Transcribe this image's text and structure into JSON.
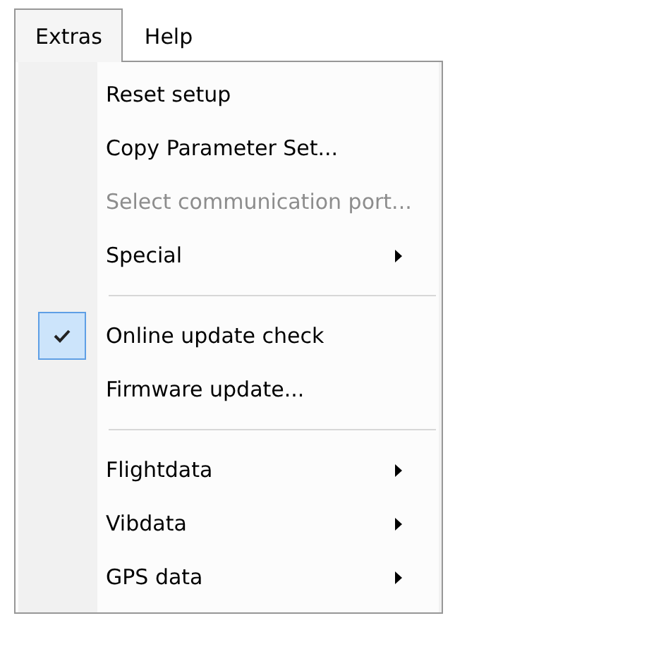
{
  "menubar": [
    {
      "label": "Extras",
      "selected": true
    },
    {
      "label": "Help",
      "selected": false
    }
  ],
  "menu": [
    {
      "kind": "item",
      "label": "Reset setup",
      "disabled": false,
      "checked": false,
      "submenu": false
    },
    {
      "kind": "item",
      "label": "Copy Parameter Set...",
      "disabled": false,
      "checked": false,
      "submenu": false
    },
    {
      "kind": "item",
      "label": "Select communication port...",
      "disabled": true,
      "checked": false,
      "submenu": false
    },
    {
      "kind": "item",
      "label": "Special",
      "disabled": false,
      "checked": false,
      "submenu": true
    },
    {
      "kind": "separator"
    },
    {
      "kind": "item",
      "label": "Online update check",
      "disabled": false,
      "checked": true,
      "submenu": false
    },
    {
      "kind": "item",
      "label": "Firmware update...",
      "disabled": false,
      "checked": false,
      "submenu": false
    },
    {
      "kind": "separator"
    },
    {
      "kind": "item",
      "label": "Flightdata",
      "disabled": false,
      "checked": false,
      "submenu": true
    },
    {
      "kind": "item",
      "label": "Vibdata",
      "disabled": false,
      "checked": false,
      "submenu": true
    },
    {
      "kind": "item",
      "label": "GPS data",
      "disabled": false,
      "checked": false,
      "submenu": true
    }
  ]
}
